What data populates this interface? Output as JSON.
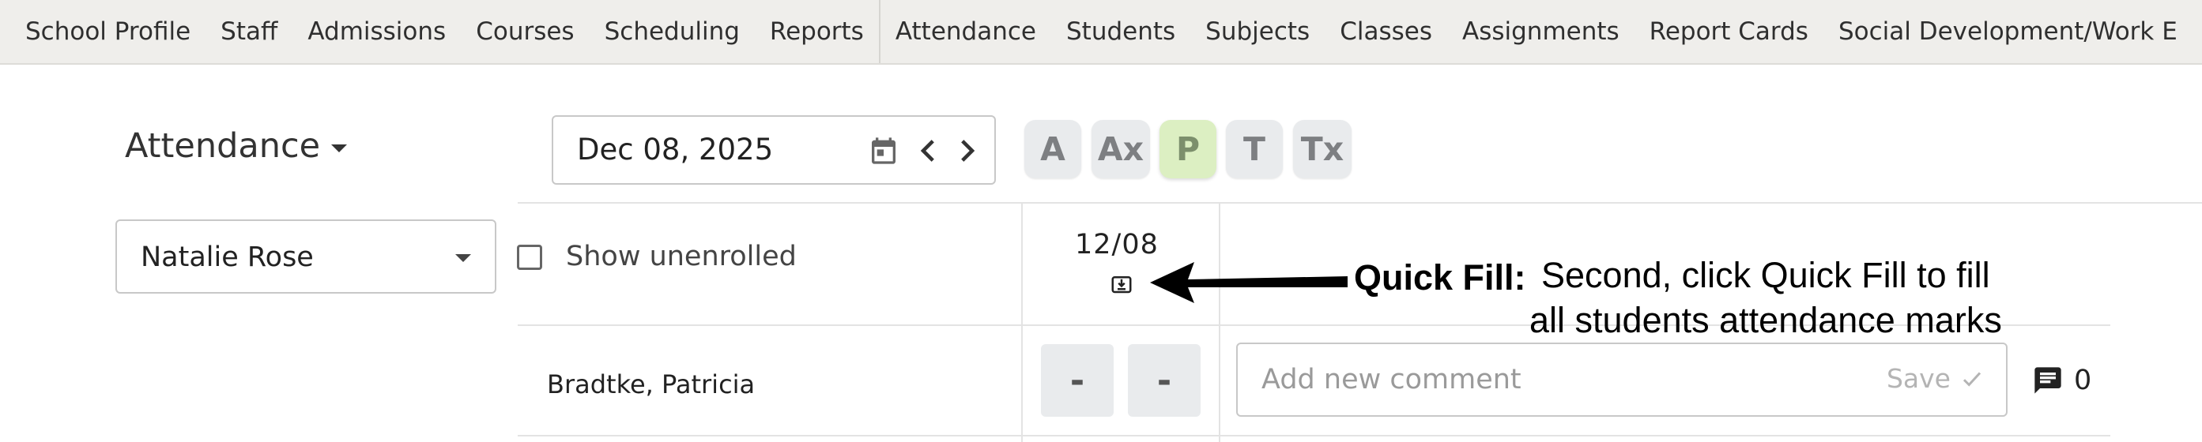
{
  "nav": {
    "items": [
      "School Profile",
      "Staff",
      "Admissions",
      "Courses",
      "Scheduling",
      "Reports",
      "Attendance",
      "Students",
      "Subjects",
      "Classes",
      "Assignments",
      "Report Cards",
      "Social Development/Work E"
    ]
  },
  "header": {
    "title": "Attendance",
    "date": "Dec 08, 2025"
  },
  "codes": [
    "A",
    "Ax",
    "P",
    "T",
    "Tx"
  ],
  "active_code": "P",
  "filters": {
    "teacher": "Natalie Rose",
    "show_unenrolled_label": "Show unenrolled"
  },
  "table": {
    "column_date": "12/08",
    "rows": [
      {
        "name": "Bradtke, Patricia",
        "marks": [
          "-",
          "-"
        ],
        "comment_placeholder": "Add new comment",
        "save_label": "Save",
        "comment_count": "0"
      }
    ]
  },
  "annotation": {
    "label": "Quick Fill:",
    "line1": "Second, click Quick Fill to fill",
    "line2": "all students attendance marks"
  },
  "colors": {
    "nav_bg": "#efeeeb",
    "active_code_bg": "#dcefc2",
    "code_bg": "#e9ebed"
  }
}
